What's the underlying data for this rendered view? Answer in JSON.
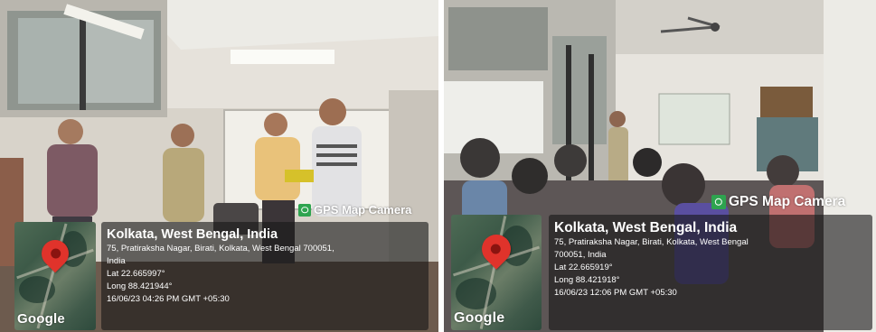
{
  "photos": [
    {
      "badge": "GPS Map Camera",
      "location": "Kolkata, West Bengal, India",
      "address_lines": [
        "75, Pratiraksha Nagar, Birati, Kolkata, West Bengal 700051,",
        "India"
      ],
      "lat": "Lat 22.665997°",
      "long": "Long 88.421944°",
      "datetime": "16/06/23 04:26 PM GMT +05:30",
      "map_brand": "Google"
    },
    {
      "badge": "GPS Map Camera",
      "location": "Kolkata, West Bengal, India",
      "address_lines": [
        "75, Pratiraksha Nagar, Birati, Kolkata, West Bengal",
        "700051, India"
      ],
      "lat": "Lat 22.665919°",
      "long": "Long 88.421918°",
      "datetime": "16/06/23 12:06 PM GMT +05:30",
      "map_brand": "Google"
    }
  ],
  "colors": {
    "pin": "#e0332b",
    "badge_icon": "#2ea44f",
    "overlay": "#191919"
  }
}
